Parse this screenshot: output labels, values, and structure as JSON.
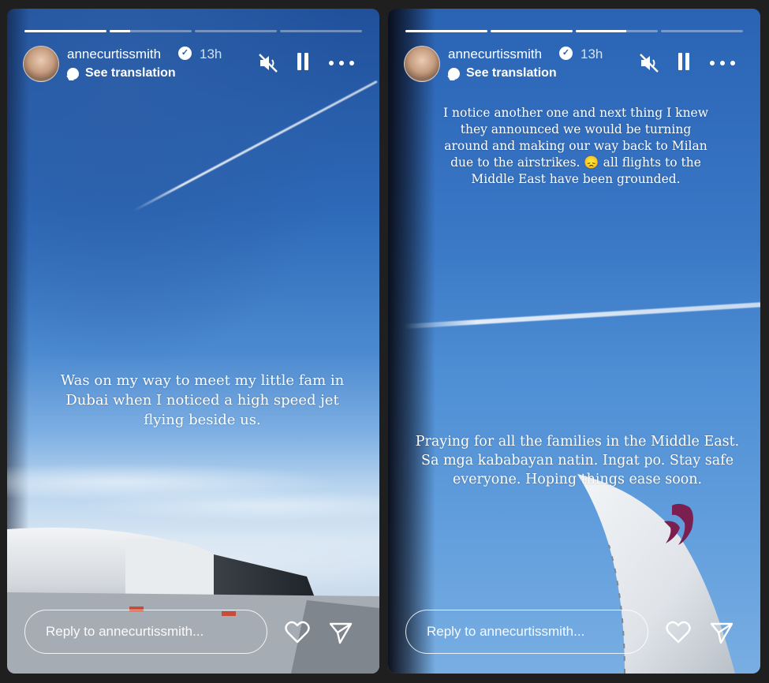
{
  "stories": [
    {
      "username": "annecurtissmith",
      "time": "13h",
      "see_translation": "See translation",
      "progress": [
        1.0,
        0.25,
        0,
        0
      ],
      "caption": "Was on my way to meet my little fam in Dubai when I noticed a high speed jet flying beside us.",
      "reply_placeholder": "Reply to annecurtissmith..."
    },
    {
      "username": "annecurtissmith",
      "time": "13h",
      "see_translation": "See translation",
      "progress": [
        1.0,
        1.0,
        0.62,
        0
      ],
      "caption_top": "I notice another one and next thing I knew they announced we would be turning around and making our way back to Milan due to the airstrikes. 😞 all flights to the Middle East have been grounded.",
      "caption_bottom": "Praying for all the families in the Middle East. Sa mga kababayan natin. Ingat po. Stay safe everyone. Hoping things ease soon.",
      "reply_placeholder": "Reply to annecurtissmith..."
    }
  ],
  "icons": {
    "verified": "verified-badge-icon",
    "mute": "muted-speaker-icon",
    "pause": "pause-icon",
    "more": "more-horizontal-icon",
    "like": "heart-icon",
    "share": "send-icon",
    "translate": "chat-bubble-icon"
  },
  "colors": {
    "page_background": "#1f1f1f",
    "wing_logo": "#7a1f4f"
  }
}
